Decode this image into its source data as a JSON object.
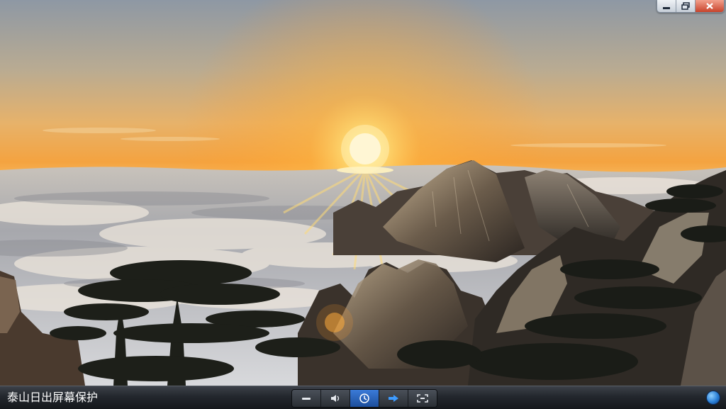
{
  "window": {
    "controls": {
      "minimize_icon": "minimize-icon",
      "restore_icon": "restore-icon",
      "close_icon": "close-icon"
    }
  },
  "wallpaper": {
    "subject": "sunrise-over-sea-of-clouds"
  },
  "toolbar": {
    "title": "泰山日出屏幕保护",
    "buttons": [
      {
        "icon": "minus-icon"
      },
      {
        "icon": "speaker-icon"
      },
      {
        "icon": "clock-icon",
        "active": true
      },
      {
        "icon": "arrow-right-icon"
      },
      {
        "icon": "fullscreen-icon"
      }
    ],
    "globe_icon": "globe-icon"
  },
  "colors": {
    "accent": "#2f6fce",
    "bar_dark": "#1b1e22",
    "close_red": "#c8432b"
  }
}
